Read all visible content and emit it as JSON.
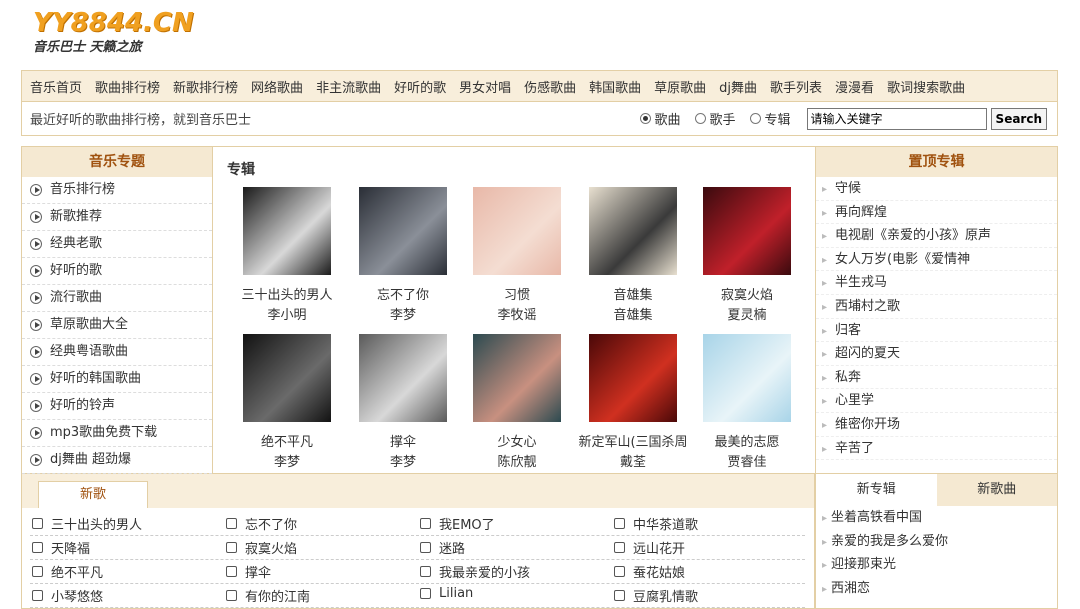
{
  "logo": {
    "main": "YY8844.CN",
    "sub": "音乐巴士 天籁之旅"
  },
  "nav": [
    "音乐首页",
    "歌曲排行榜",
    "新歌排行榜",
    "网络歌曲",
    "非主流歌曲",
    "好听的歌",
    "男女对唱",
    "伤感歌曲",
    "韩国歌曲",
    "草原歌曲",
    "dj舞曲",
    "歌手列表",
    "漫漫看",
    "歌词搜索歌曲"
  ],
  "search": {
    "tagline": "最近好听的歌曲排行榜，就到音乐巴士",
    "options": [
      "歌曲",
      "歌手",
      "专辑"
    ],
    "selected": "歌曲",
    "input_value": "请输入关键字",
    "button": "Search"
  },
  "left": {
    "title": "音乐专题",
    "items": [
      "音乐排行榜",
      "新歌推荐",
      "经典老歌",
      "好听的歌",
      "流行歌曲",
      "草原歌曲大全",
      "经典粤语歌曲",
      "好听的韩国歌曲",
      "好听的铃声",
      "mp3歌曲免费下载",
      "dj舞曲 超劲爆"
    ]
  },
  "albums": {
    "title": "专辑",
    "items": [
      {
        "name": "三十出头的男人",
        "artist": "李小明",
        "c1": "#1a1a1a",
        "c2": "#d8d8d8"
      },
      {
        "name": "忘不了你",
        "artist": "李梦",
        "c1": "#2a2e36",
        "c2": "#8a8f98"
      },
      {
        "name": "习惯",
        "artist": "李牧谣",
        "c1": "#e8b8a8",
        "c2": "#f4ddd2"
      },
      {
        "name": "音雄集",
        "artist": "音雄集",
        "c1": "#e8e0d0",
        "c2": "#3a3a3a"
      },
      {
        "name": "寂寞火焰",
        "artist": "夏灵楠",
        "c1": "#3a0a0e",
        "c2": "#c0202a"
      },
      {
        "name": "绝不平凡",
        "artist": "李梦",
        "c1": "#121212",
        "c2": "#6a6a6a"
      },
      {
        "name": "撑伞",
        "artist": "李梦",
        "c1": "#5a5a5a",
        "c2": "#d8d8d8"
      },
      {
        "name": "少女心",
        "artist": "陈欣靓",
        "c1": "#2c4a50",
        "c2": "#c89080"
      },
      {
        "name": "新定军山(三国杀周",
        "artist": "戴荃",
        "c1": "#4a0808",
        "c2": "#d03020"
      },
      {
        "name": "最美的志愿",
        "artist": "贾睿佳",
        "c1": "#a8d4e8",
        "c2": "#e8f4f8"
      }
    ]
  },
  "right": {
    "title": "置顶专辑",
    "items": [
      "守候",
      "再向辉煌",
      "电视剧《亲爱的小孩》原声",
      "女人万岁(电影《爱情神",
      "半生戎马",
      "西埔村之歌",
      "归客",
      "超闪的夏天",
      "私奔",
      "心里学",
      "维密你开场",
      "辛苦了"
    ]
  },
  "newsongs": {
    "tab": "新歌",
    "rows": [
      [
        "三十出头的男人",
        "忘不了你",
        "我EMO了",
        "中华茶道歌"
      ],
      [
        "天降福",
        "寂寞火焰",
        "迷路",
        "远山花开"
      ],
      [
        "绝不平凡",
        "撑伞",
        "我最亲爱的小孩",
        "蚕花姑娘"
      ],
      [
        "小琴悠悠",
        "有你的江南",
        "Lilian",
        "豆腐乳情歌"
      ]
    ]
  },
  "rtabs": {
    "tabs": [
      "新专辑",
      "新歌曲"
    ],
    "items": [
      "坐着高铁看中国",
      "亲爱的我是多么爱你",
      "迎接那束光",
      "西湘恋"
    ]
  }
}
